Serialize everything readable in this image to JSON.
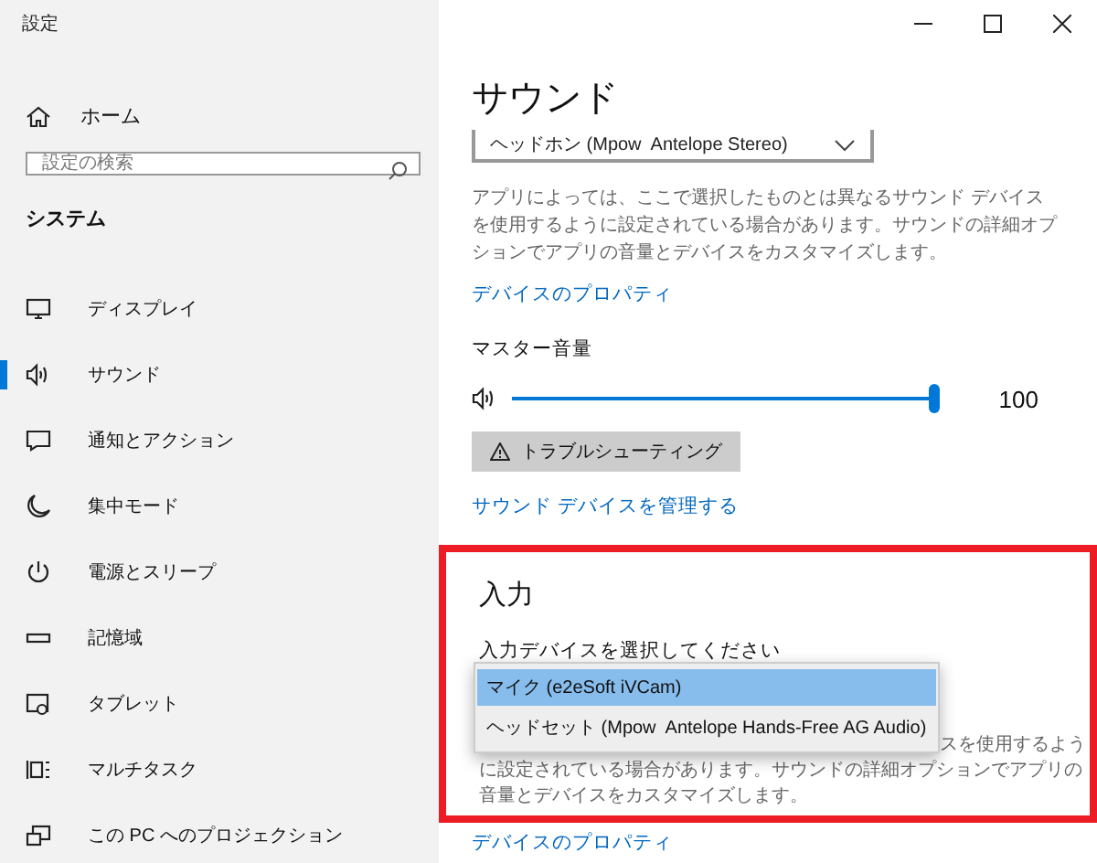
{
  "window": {
    "title": "設定"
  },
  "sidebar": {
    "home": "ホーム",
    "search": {
      "placeholder": "設定の検索"
    },
    "section": "システム",
    "items": [
      {
        "label": "ディスプレイ",
        "kind": "display",
        "selected": false
      },
      {
        "label": "サウンド",
        "kind": "sound",
        "selected": true
      },
      {
        "label": "通知とアクション",
        "kind": "notify",
        "selected": false
      },
      {
        "label": "集中モード",
        "kind": "moon",
        "selected": false
      },
      {
        "label": "電源とスリープ",
        "kind": "power",
        "selected": false
      },
      {
        "label": "記憶域",
        "kind": "storage",
        "selected": false
      },
      {
        "label": "タブレット",
        "kind": "tablet",
        "selected": false
      },
      {
        "label": "マルチタスク",
        "kind": "multitask",
        "selected": false
      },
      {
        "label": "この PC へのプロジェクション",
        "kind": "project",
        "selected": false
      }
    ]
  },
  "content": {
    "title": "サウンド",
    "output_device": "ヘッドホン (Mpow  Antelope Stereo)",
    "output_note": "アプリによっては、ここで選択したものとは異なるサウンド デバイスを使用するように設定されている場合があります。サウンドの詳細オプションでアプリの音量とデバイスをカスタマイズします。",
    "device_properties_link": "デバイスのプロパティ",
    "master_volume": {
      "label": "マスター音量",
      "level": 1.0,
      "reading": "100"
    },
    "troubleshoot_button": "トラブルシューティング",
    "manage_link": "サウンド デバイスを管理する"
  },
  "input": {
    "highlighted": true,
    "title": "入力",
    "select_label": "入力デバイスを選択してください",
    "options": [
      {
        "label": "マイク (e2eSoft iVCam)",
        "selected": true
      },
      {
        "label": "ヘッドセット (Mpow  Antelope Hands-Free AG Audio)",
        "selected": false
      }
    ],
    "note_first_line": "スを使用するよう",
    "note_rest": "に設定されている場合があります。サウンドの詳細オプションでアプリの音量とデバイスをカスタマイズします。",
    "device_properties_link": "デバイスのプロパティ"
  }
}
